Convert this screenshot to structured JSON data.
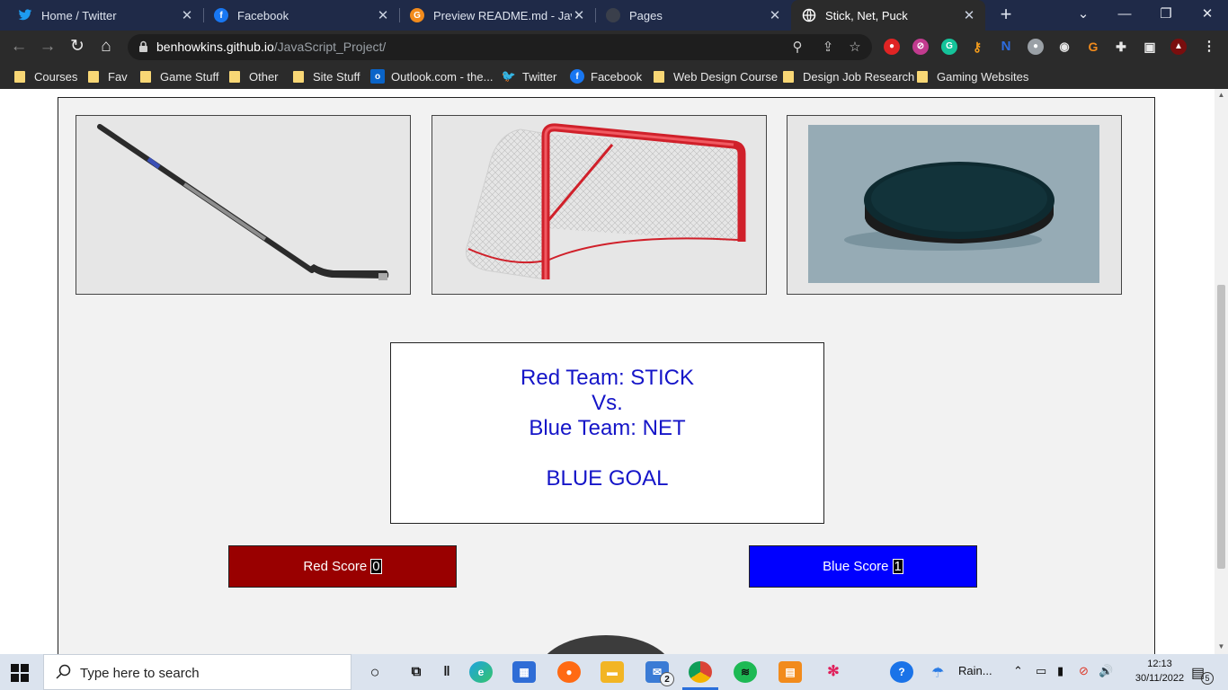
{
  "browser": {
    "tabs": [
      {
        "title": "Home / Twitter",
        "icon": "twitter-icon",
        "color": "#1d9bf0",
        "active": false
      },
      {
        "title": "Facebook",
        "icon": "facebook-icon",
        "color": "#1877f2",
        "active": false
      },
      {
        "title": "Preview README.md - JavaScript_Project",
        "icon": "preview-icon",
        "color": "#f28b1c",
        "active": false
      },
      {
        "title": "Pages",
        "icon": "github-icon",
        "color": "#3a3f4b",
        "active": false
      },
      {
        "title": "Stick, Net, Puck",
        "icon": "globe-icon",
        "color": "#ffffff",
        "active": true
      }
    ],
    "url_host": "benhowkins.github.io",
    "url_path": "/JavaScript_Project/",
    "bookmarks": [
      {
        "label": "Courses",
        "type": "folder"
      },
      {
        "label": "Fav",
        "type": "folder"
      },
      {
        "label": "Game Stuff",
        "type": "folder"
      },
      {
        "label": "Other",
        "type": "folder"
      },
      {
        "label": "Site Stuff",
        "type": "folder"
      },
      {
        "label": "Outlook.com - the...",
        "type": "outlook-icon"
      },
      {
        "label": "Twitter",
        "type": "twitter-icon"
      },
      {
        "label": "Facebook",
        "type": "facebook-icon"
      },
      {
        "label": "Web Design Course",
        "type": "folder"
      },
      {
        "label": "Design Job Research",
        "type": "folder"
      },
      {
        "label": "Gaming Websites",
        "type": "folder"
      }
    ]
  },
  "game": {
    "choices": [
      "stick",
      "net",
      "puck"
    ],
    "result": {
      "red_line": "Red Team: STICK",
      "vs": "Vs.",
      "blue_line": "Blue Team: NET",
      "outcome": "BLUE GOAL"
    },
    "red_score_label": "Red Score",
    "red_score": "0",
    "blue_score_label": "Blue Score",
    "blue_score": "1"
  },
  "taskbar": {
    "search_placeholder": "Type here to search",
    "weather": "Rain...",
    "time": "12:13",
    "date": "30/11/2022",
    "mail_badge": "2",
    "notif_badge": "5"
  }
}
